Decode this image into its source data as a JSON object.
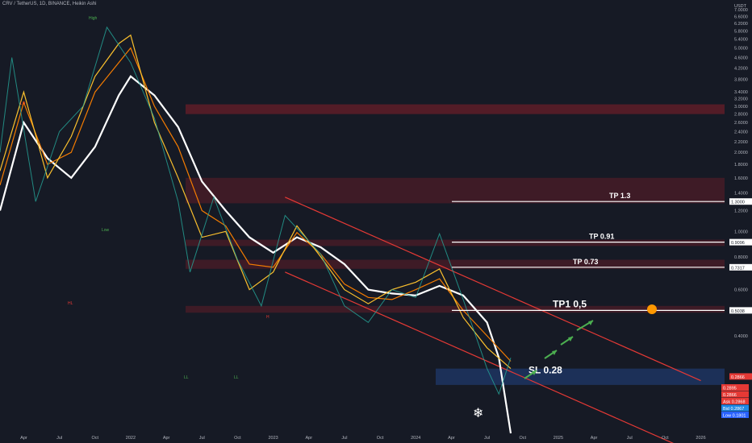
{
  "header": {
    "symbol_title": "CRV / TetherUS, 1D, BINANCE, Heikin Ashi",
    "currency": "USDT"
  },
  "colors": {
    "background": "#161a25",
    "axis_text": "#b2b5be",
    "red_zone": "#5a1d28",
    "resistance_line": "#e53935",
    "support_line": "#e53935",
    "white_ma": "#ffffff",
    "orange_ma": "#f57c00",
    "yellow_ma": "#fbc02d",
    "green_arrow": "#26a69a",
    "tp_line": "#ffffff",
    "sl_zone": "#1f3b6e",
    "price_candle": "#5d6170"
  },
  "icons": {
    "target_icon": "sun-icon",
    "stop_icon": "snowflake-icon"
  },
  "chart_data": {
    "type": "line",
    "title": "",
    "price_scale": "log",
    "ylim": [
      0.17,
      7.0
    ],
    "y_ticks": [
      "7.0000",
      "6.6000",
      "6.2000",
      "5.8000",
      "5.4000",
      "5.0000",
      "4.6000",
      "4.2000",
      "3.8000",
      "3.4000",
      "3.2000",
      "3.0000",
      "2.8000",
      "2.6000",
      "2.4000",
      "2.2000",
      "2.0000",
      "1.8000",
      "1.6000",
      "1.4000",
      "1.2000",
      "1.0000",
      "0.8000",
      "0.6000",
      "0.4000",
      "0.2000"
    ],
    "x_ticks": [
      "Apr",
      "Jul",
      "Oct",
      "2022",
      "Apr",
      "Jul",
      "Oct",
      "2023",
      "Apr",
      "Jul",
      "Oct",
      "2024",
      "Apr",
      "Jul",
      "Oct",
      "2025",
      "Apr",
      "Jul",
      "Oct",
      "2026"
    ],
    "x_range": [
      "2021-02",
      "2026-03"
    ],
    "series": [
      {
        "points": [
          [
            "2021-02",
            1.2
          ],
          [
            "2021-04",
            2.6
          ],
          [
            "2021-06",
            1.9
          ],
          [
            "2021-08",
            1.6
          ],
          [
            "2021-10",
            2.1
          ],
          [
            "2021-12",
            3.3
          ],
          [
            "2022-01",
            3.9
          ],
          [
            "2022-03",
            3.3
          ],
          [
            "2022-05",
            2.5
          ],
          [
            "2022-07",
            1.55
          ],
          [
            "2022-09",
            1.2
          ],
          [
            "2022-11",
            0.95
          ],
          [
            "2023-01",
            0.83
          ],
          [
            "2023-03",
            0.95
          ],
          [
            "2023-05",
            0.87
          ],
          [
            "2023-07",
            0.75
          ],
          [
            "2023-09",
            0.6
          ],
          [
            "2023-11",
            0.58
          ],
          [
            "2024-01",
            0.57
          ],
          [
            "2024-03",
            0.62
          ],
          [
            "2024-05",
            0.57
          ],
          [
            "2024-07",
            0.45
          ],
          [
            "2024-08",
            0.33
          ],
          [
            "2024-09",
            0.17
          ]
        ]
      },
      {
        "points": [
          [
            "2021-02",
            1.5
          ],
          [
            "2021-04",
            3.1
          ],
          [
            "2021-06",
            1.8
          ],
          [
            "2021-08",
            2.0
          ],
          [
            "2021-10",
            3.4
          ],
          [
            "2021-12",
            4.4
          ],
          [
            "2022-01",
            5.0
          ],
          [
            "2022-03",
            3.0
          ],
          [
            "2022-05",
            2.1
          ],
          [
            "2022-07",
            1.2
          ],
          [
            "2022-09",
            1.05
          ],
          [
            "2022-11",
            0.75
          ],
          [
            "2023-01",
            0.73
          ],
          [
            "2023-03",
            0.99
          ],
          [
            "2023-05",
            0.82
          ],
          [
            "2023-07",
            0.63
          ],
          [
            "2023-09",
            0.56
          ],
          [
            "2023-11",
            0.55
          ],
          [
            "2024-01",
            0.6
          ],
          [
            "2024-03",
            0.66
          ],
          [
            "2024-05",
            0.5
          ],
          [
            "2024-07",
            0.4
          ],
          [
            "2024-09",
            0.32
          ]
        ]
      },
      {
        "points": [
          [
            "2021-02",
            1.7
          ],
          [
            "2021-04",
            3.4
          ],
          [
            "2021-06",
            1.6
          ],
          [
            "2021-08",
            2.3
          ],
          [
            "2021-10",
            3.9
          ],
          [
            "2021-12",
            5.2
          ],
          [
            "2022-01",
            5.6
          ],
          [
            "2022-03",
            2.6
          ],
          [
            "2022-05",
            1.6
          ],
          [
            "2022-07",
            0.95
          ],
          [
            "2022-09",
            1.0
          ],
          [
            "2022-11",
            0.6
          ],
          [
            "2023-01",
            0.7
          ],
          [
            "2023-03",
            1.05
          ],
          [
            "2023-05",
            0.8
          ],
          [
            "2023-07",
            0.6
          ],
          [
            "2023-09",
            0.53
          ],
          [
            "2023-11",
            0.6
          ],
          [
            "2024-01",
            0.64
          ],
          [
            "2024-03",
            0.72
          ],
          [
            "2024-05",
            0.47
          ],
          [
            "2024-07",
            0.36
          ],
          [
            "2024-09",
            0.3
          ]
        ]
      },
      {
        "points": [
          [
            "2021-02",
            2.0
          ],
          [
            "2021-03",
            4.6
          ],
          [
            "2021-05",
            1.3
          ],
          [
            "2021-07",
            2.4
          ],
          [
            "2021-09",
            3.0
          ],
          [
            "2021-11",
            6.0
          ],
          [
            "2022-01",
            4.4
          ],
          [
            "2022-03",
            2.7
          ],
          [
            "2022-05",
            1.3
          ],
          [
            "2022-06",
            0.7
          ],
          [
            "2022-08",
            1.35
          ],
          [
            "2022-10",
            0.78
          ],
          [
            "2022-12",
            0.52
          ],
          [
            "2023-02",
            1.15
          ],
          [
            "2023-05",
            0.82
          ],
          [
            "2023-07",
            0.52
          ],
          [
            "2023-09",
            0.45
          ],
          [
            "2023-11",
            0.6
          ],
          [
            "2024-01",
            0.56
          ],
          [
            "2024-03",
            0.98
          ],
          [
            "2024-05",
            0.55
          ],
          [
            "2024-07",
            0.3
          ],
          [
            "2024-08",
            0.24
          ],
          [
            "2024-09",
            0.33
          ]
        ]
      }
    ],
    "zones": [
      {
        "from": 2.8,
        "to": 3.05
      },
      {
        "from": 1.28,
        "to": 1.6
      },
      {
        "from": 0.88,
        "to": 0.93
      },
      {
        "from": 0.72,
        "to": 0.78
      },
      {
        "from": 0.49,
        "to": 0.52
      }
    ],
    "trend_lines": [
      {
        "from": [
          "2023-02",
          1.35
        ],
        "to": [
          "2026-01",
          0.27
        ]
      },
      {
        "from": [
          "2023-02",
          0.7
        ],
        "to": [
          "2026-01",
          0.14
        ]
      }
    ],
    "targets": [
      {
        "label": "TP 1.3",
        "value": 1.3,
        "price_label": "1.3000"
      },
      {
        "label": "TP 0.91",
        "value": 0.91,
        "price_label": "0.9096"
      },
      {
        "label": "TP 0.73",
        "value": 0.73,
        "price_label": "0.7317"
      },
      {
        "label": "TP1 0,5",
        "value": 0.5,
        "price_label": "0.5038"
      },
      {
        "label": "SL 0.28",
        "value": 0.28,
        "price_label": "0.2866"
      }
    ],
    "annotations": [
      "High",
      "LH",
      "Low",
      "HL",
      "LL",
      "H",
      "LL"
    ],
    "price_tags": [
      {
        "label": "0.2895",
        "color": "#e53935"
      },
      {
        "label": "0.2866",
        "color": "#e53935"
      },
      {
        "label": "Ask 0.2868",
        "color": "#e53935"
      },
      {
        "label": "Bid 0.2867",
        "color": "#1e88e5"
      },
      {
        "label": "Low 0.1801",
        "color": "#2962ff"
      }
    ]
  }
}
